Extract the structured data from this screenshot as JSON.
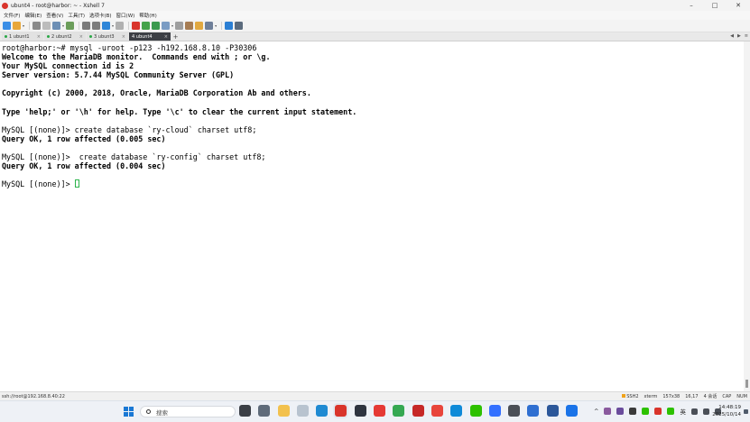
{
  "window": {
    "title": "ubunt4 - root@harbor: ~ - Xshell 7",
    "controls": {
      "minimize": "–",
      "maximize": "□",
      "close": "✕"
    }
  },
  "menu": [
    "文件(F)",
    "编辑(E)",
    "查看(V)",
    "工具(T)",
    "选项卡(B)",
    "窗口(W)",
    "帮助(H)"
  ],
  "toolbar": {
    "buttons": [
      {
        "icon": "new-session-icon",
        "color": "#3a8ee6"
      },
      {
        "icon": "open-folder-icon",
        "color": "#e8a73a"
      },
      {
        "icon": "reconnect-icon",
        "color": "#8a8a8a"
      },
      {
        "icon": "disconnect-icon",
        "color": "#bcbcbc"
      },
      {
        "icon": "copy-icon",
        "color": "#6d8fb5"
      },
      {
        "icon": "paste-icon",
        "color": "#6b9d5a"
      },
      {
        "icon": "find-icon",
        "color": "#7a7a7a"
      },
      {
        "icon": "print-icon",
        "color": "#7d7d7d"
      },
      {
        "icon": "globe-icon",
        "color": "#2f86d8"
      },
      {
        "icon": "key-icon",
        "color": "#b0b0b0"
      },
      {
        "icon": "xftp-icon",
        "color": "#d9342b"
      },
      {
        "icon": "xmanager-icon",
        "color": "#44a34a"
      },
      {
        "icon": "script-icon",
        "color": "#3c9a4f"
      },
      {
        "icon": "transfer-icon",
        "color": "#7a9cc4"
      },
      {
        "icon": "keyboard-icon",
        "color": "#9e9e9e"
      },
      {
        "icon": "pen-icon",
        "color": "#a67c52"
      },
      {
        "icon": "lock-icon",
        "color": "#e1a840"
      },
      {
        "icon": "layout-icon",
        "color": "#6e7f99"
      },
      {
        "icon": "help-icon",
        "color": "#2b7fd4"
      },
      {
        "icon": "info-icon",
        "color": "#5b6b7d"
      }
    ]
  },
  "tabs": [
    {
      "label": "1 ubunt1",
      "active": false
    },
    {
      "label": "2 ubunt2",
      "active": false
    },
    {
      "label": "3 ubunt3",
      "active": false
    },
    {
      "label": "4 ubunt4",
      "active": true
    }
  ],
  "terminal": {
    "lines": [
      {
        "text": "root@harbor:~# mysql -uroot -p123 -h192.168.8.10 -P30306",
        "bold": false
      },
      {
        "text": "Welcome to the MariaDB monitor.  Commands end with ; or \\g.",
        "bold": true
      },
      {
        "text": "Your MySQL connection id is 2",
        "bold": true
      },
      {
        "text": "Server version: 5.7.44 MySQL Community Server (GPL)",
        "bold": true
      },
      {
        "text": "",
        "bold": false
      },
      {
        "text": "Copyright (c) 2000, 2018, Oracle, MariaDB Corporation Ab and others.",
        "bold": true
      },
      {
        "text": "",
        "bold": false
      },
      {
        "text": "Type 'help;' or '\\h' for help. Type '\\c' to clear the current input statement.",
        "bold": true
      },
      {
        "text": "",
        "bold": false
      },
      {
        "text": "MySQL [(none)]> create database `ry-cloud` charset utf8;",
        "bold": false
      },
      {
        "text": "Query OK, 1 row affected (0.005 sec)",
        "bold": true
      },
      {
        "text": "",
        "bold": false
      },
      {
        "text": "MySQL [(none)]>  create database `ry-config` charset utf8;",
        "bold": false
      },
      {
        "text": "Query OK, 1 row affected (0.004 sec)",
        "bold": true
      },
      {
        "text": "",
        "bold": false
      }
    ],
    "prompt": "MySQL [(none)]> ",
    "cursor_color": "#2bb34a"
  },
  "statusbar": {
    "connection": "ssh://root@192.168.8.40:22",
    "protocol": "SSH2",
    "term": "xterm",
    "size": "157x38",
    "position": "16,17",
    "sessions": "4 会话",
    "caps": "CAP",
    "num": "NUM"
  },
  "taskbar": {
    "search_placeholder": "搜索",
    "apps": [
      {
        "icon": "task-view-icon",
        "color": "#3b3f46"
      },
      {
        "icon": "settings-icon",
        "color": "#5f6b7a"
      },
      {
        "icon": "file-explorer-icon",
        "color": "#f2c14e"
      },
      {
        "icon": "clipboard-icon",
        "color": "#b8c3cf"
      },
      {
        "icon": "vscode-icon",
        "color": "#1f8ad2"
      },
      {
        "icon": "xshell-icon",
        "color": "#d9342b"
      },
      {
        "icon": "terminal-app-icon",
        "color": "#2e3440"
      },
      {
        "icon": "red-app-icon",
        "color": "#e53935"
      },
      {
        "icon": "green-app-icon",
        "color": "#34a853"
      },
      {
        "icon": "notes-app-icon",
        "color": "#c62828"
      },
      {
        "icon": "chrome-icon",
        "color": "#e8453c"
      },
      {
        "icon": "edge-icon",
        "color": "#0f8ad8"
      },
      {
        "icon": "wechat-icon",
        "color": "#2dc100"
      },
      {
        "icon": "feishu-icon",
        "color": "#3370ff"
      },
      {
        "icon": "cube-app-icon",
        "color": "#4a4f57"
      },
      {
        "icon": "pdf-app-icon",
        "color": "#2f6fd1"
      },
      {
        "icon": "word-icon",
        "color": "#2b579a"
      },
      {
        "icon": "vmware-icon",
        "color": "#1a73e8"
      }
    ],
    "tray_chevron": "^",
    "tray_icons": [
      {
        "icon": "tray-app-1-icon",
        "color": "#8a5a9e"
      },
      {
        "icon": "tray-app-2-icon",
        "color": "#6a4c9c"
      },
      {
        "icon": "tray-app-3-icon",
        "color": "#3a3a3a"
      },
      {
        "icon": "tray-wechat-icon",
        "color": "#2dc100"
      },
      {
        "icon": "tray-app-5-icon",
        "color": "#d9342b"
      },
      {
        "icon": "tray-app-6-icon",
        "color": "#2dc100"
      }
    ],
    "ime": "英",
    "time": "14:48:19",
    "date": "2025/10/14"
  }
}
